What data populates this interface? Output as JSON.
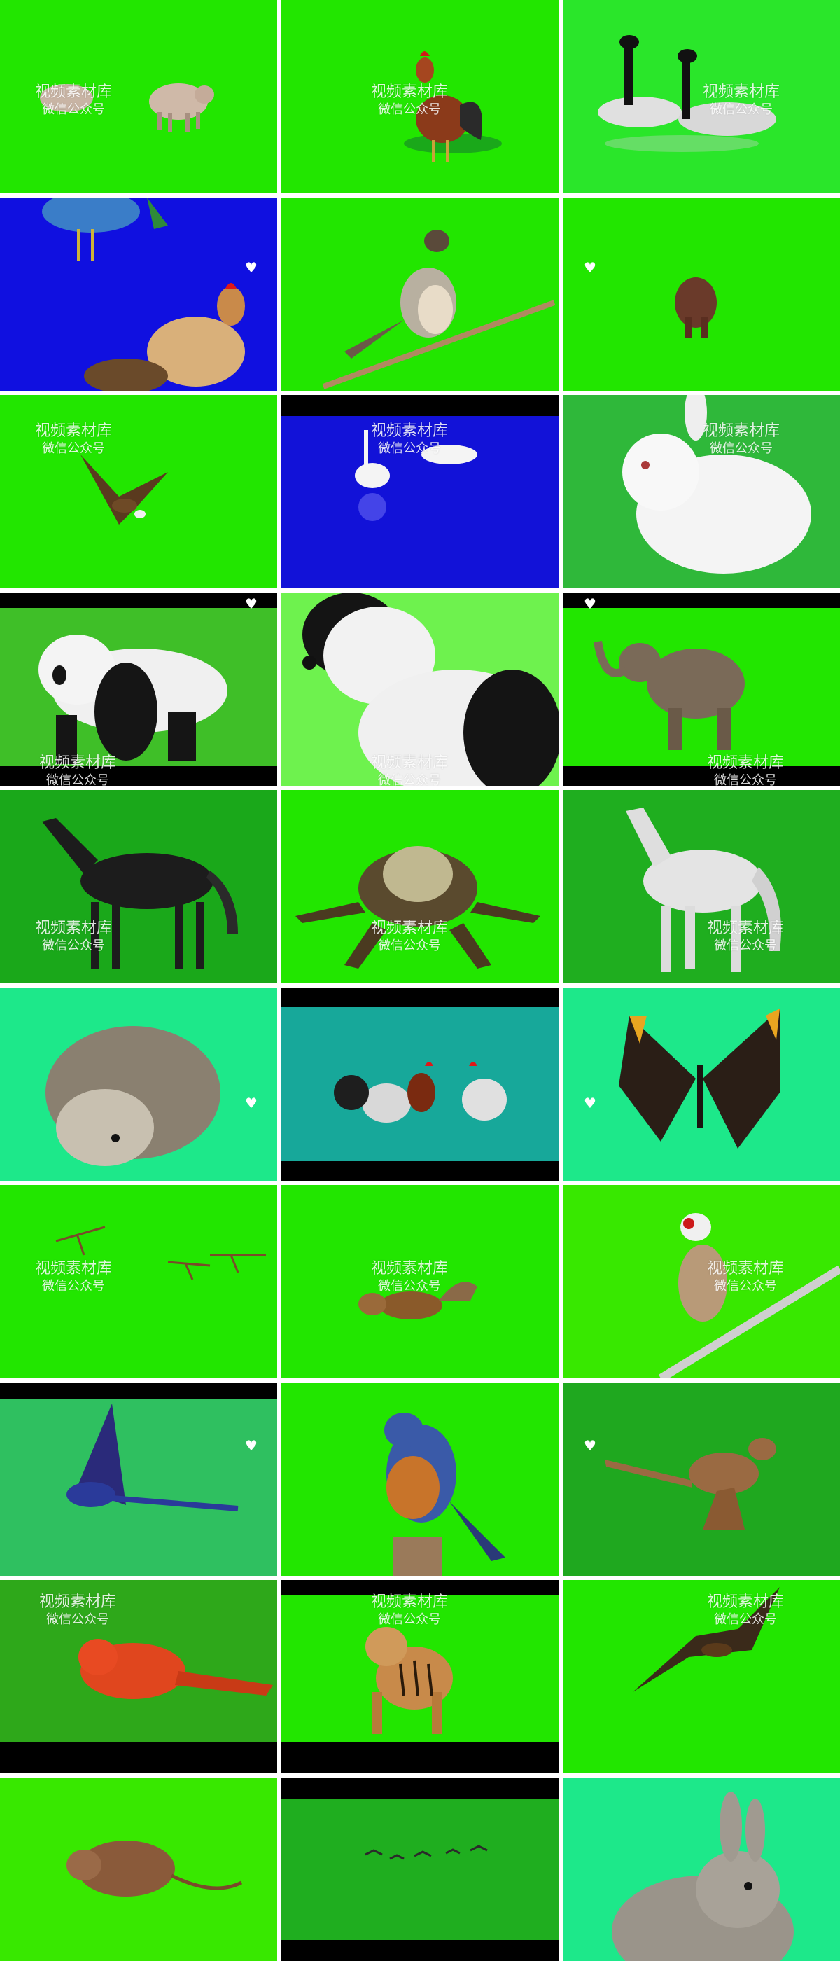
{
  "watermark": {
    "line1": "视频素材库",
    "line2": "微信公众号"
  },
  "heart_glyph": "♥",
  "colors": {
    "green_bright": "#22e600",
    "green_mid": "#2fd615",
    "green_dark": "#1aa81a",
    "mint": "#1de88a",
    "blue_screen": "#1010e0",
    "teal": "#17a89a"
  },
  "tiles": [
    {
      "subject": "pig"
    },
    {
      "subject": "rooster"
    },
    {
      "subject": "geese"
    },
    {
      "subject": "bird and rooster"
    },
    {
      "subject": "robin on branch"
    },
    {
      "subject": "elephant small"
    },
    {
      "subject": "eagle flying"
    },
    {
      "subject": "swans"
    },
    {
      "subject": "white rabbit"
    },
    {
      "subject": "panda"
    },
    {
      "subject": "black and white dog"
    },
    {
      "subject": "elephant"
    },
    {
      "subject": "black horse"
    },
    {
      "subject": "frog"
    },
    {
      "subject": "white horse"
    },
    {
      "subject": "hedgehog"
    },
    {
      "subject": "roosters"
    },
    {
      "subject": "butterfly"
    },
    {
      "subject": "mosquitoes"
    },
    {
      "subject": "chipmunk"
    },
    {
      "subject": "goldfinch"
    },
    {
      "subject": "blue parrot"
    },
    {
      "subject": "bluebird"
    },
    {
      "subject": "kangaroo"
    },
    {
      "subject": "red bird"
    },
    {
      "subject": "tiger"
    },
    {
      "subject": "hawk"
    },
    {
      "subject": "mouse"
    },
    {
      "subject": "flying birds"
    },
    {
      "subject": "grey rabbit"
    }
  ]
}
